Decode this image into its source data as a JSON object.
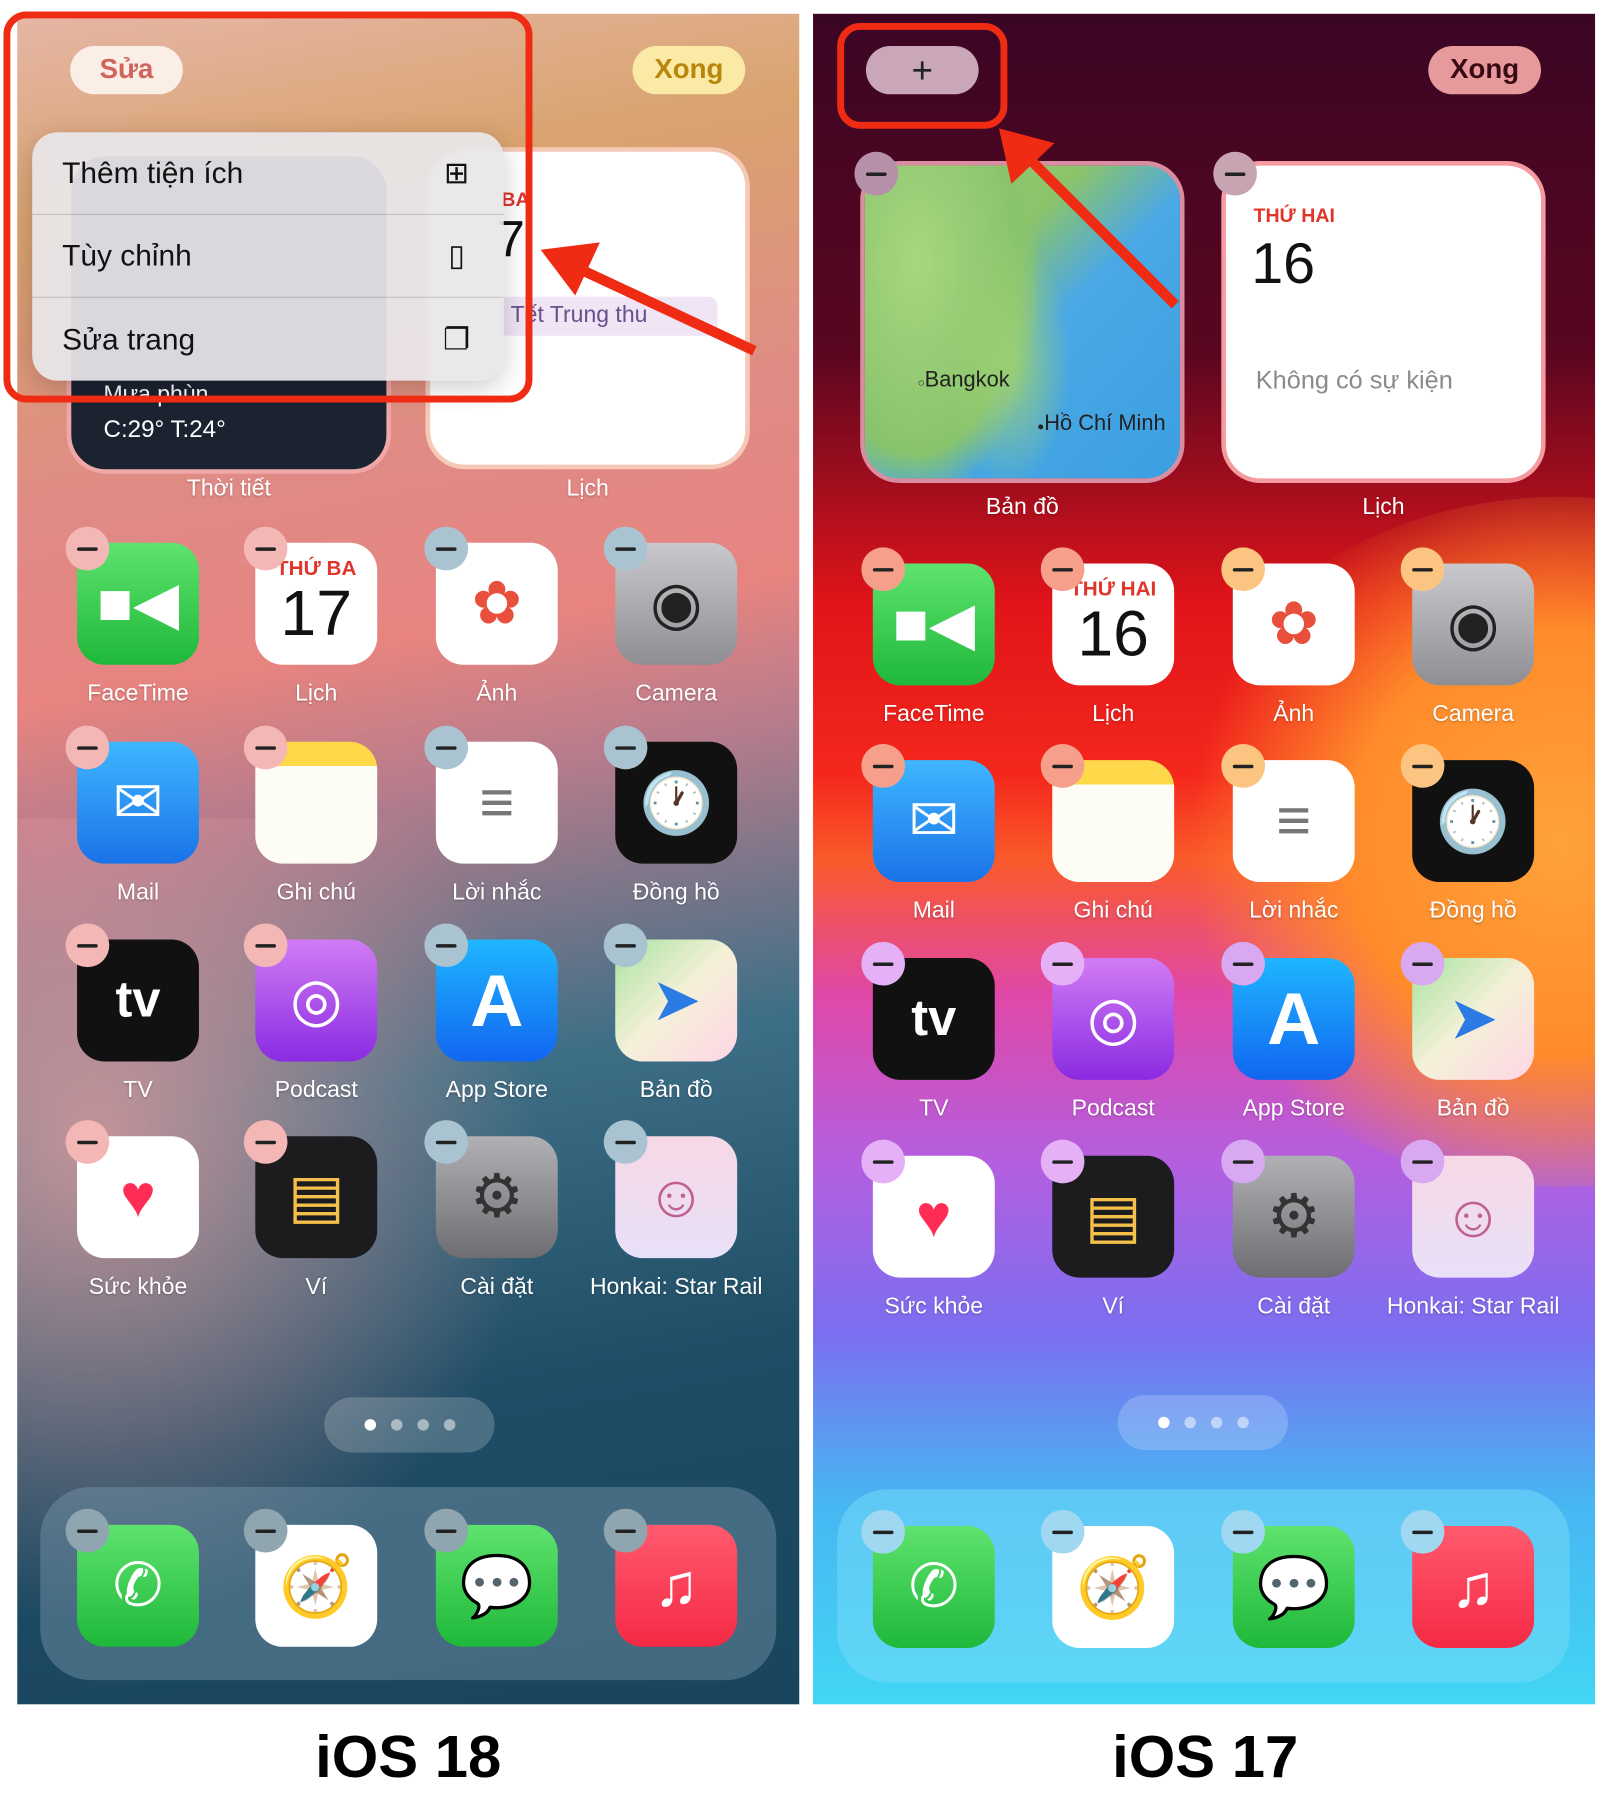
{
  "ios18": {
    "edit_button": "Sửa",
    "done_button": "Xong",
    "menu": [
      {
        "label": "Thêm tiện ích",
        "icon": "add-widget-icon"
      },
      {
        "label": "Tùy chỉnh",
        "icon": "customize-icon"
      },
      {
        "label": "Sửa trang",
        "icon": "edit-pages-icon"
      }
    ],
    "weather_widget": {
      "condition": "Mưa phùn",
      "temps": "C:29° T:24°",
      "label": "Thời tiết"
    },
    "calendar_widget": {
      "day": "BA",
      "date": "7",
      "event": "Tết Trung thu",
      "label": "Lịch"
    },
    "apps": [
      {
        "label": "FaceTime",
        "icon": "facetime"
      },
      {
        "label": "Lịch",
        "icon": "calendar",
        "day": "THỨ BA",
        "date": "17"
      },
      {
        "label": "Ảnh",
        "icon": "photos"
      },
      {
        "label": "Camera",
        "icon": "camera"
      },
      {
        "label": "Mail",
        "icon": "mail"
      },
      {
        "label": "Ghi chú",
        "icon": "notes"
      },
      {
        "label": "Lời nhắc",
        "icon": "reminders"
      },
      {
        "label": "Đồng hồ",
        "icon": "clock"
      },
      {
        "label": "TV",
        "icon": "tv"
      },
      {
        "label": "Podcast",
        "icon": "podcast"
      },
      {
        "label": "App Store",
        "icon": "appstore"
      },
      {
        "label": "Bản đồ",
        "icon": "maps"
      },
      {
        "label": "Sức khỏe",
        "icon": "health"
      },
      {
        "label": "Ví",
        "icon": "wallet"
      },
      {
        "label": "Cài đặt",
        "icon": "settings"
      },
      {
        "label": "Honkai: Star Rail",
        "icon": "honkai"
      }
    ],
    "dock": [
      "phone",
      "safari",
      "messages",
      "music"
    ],
    "pages": 4,
    "current_page": 1,
    "caption": "iOS 18"
  },
  "ios17": {
    "add_button": "+",
    "done_button": "Xong",
    "map_widget": {
      "places": [
        "Bangkok",
        "Hồ Chí Minh"
      ],
      "label": "Bản đồ"
    },
    "calendar_widget": {
      "day": "THỨ HAI",
      "date": "16",
      "event": "Không có sự kiện",
      "label": "Lịch"
    },
    "apps": [
      {
        "label": "FaceTime",
        "icon": "facetime"
      },
      {
        "label": "Lịch",
        "icon": "calendar",
        "day": "THỨ HAI",
        "date": "16"
      },
      {
        "label": "Ảnh",
        "icon": "photos"
      },
      {
        "label": "Camera",
        "icon": "camera"
      },
      {
        "label": "Mail",
        "icon": "mail"
      },
      {
        "label": "Ghi chú",
        "icon": "notes"
      },
      {
        "label": "Lời nhắc",
        "icon": "reminders"
      },
      {
        "label": "Đồng hồ",
        "icon": "clock"
      },
      {
        "label": "TV",
        "icon": "tv"
      },
      {
        "label": "Podcast",
        "icon": "podcast"
      },
      {
        "label": "App Store",
        "icon": "appstore"
      },
      {
        "label": "Bản đồ",
        "icon": "maps"
      },
      {
        "label": "Sức khỏe",
        "icon": "health"
      },
      {
        "label": "Ví",
        "icon": "wallet"
      },
      {
        "label": "Cài đặt",
        "icon": "settings"
      },
      {
        "label": "Honkai: Star Rail",
        "icon": "honkai"
      }
    ],
    "dock": [
      "phone",
      "safari",
      "messages",
      "music"
    ],
    "pages": 4,
    "current_page": 1,
    "caption": "iOS 17"
  },
  "colors": {
    "highlight": "#ef2b14",
    "calendar_red": "#e0352b"
  }
}
